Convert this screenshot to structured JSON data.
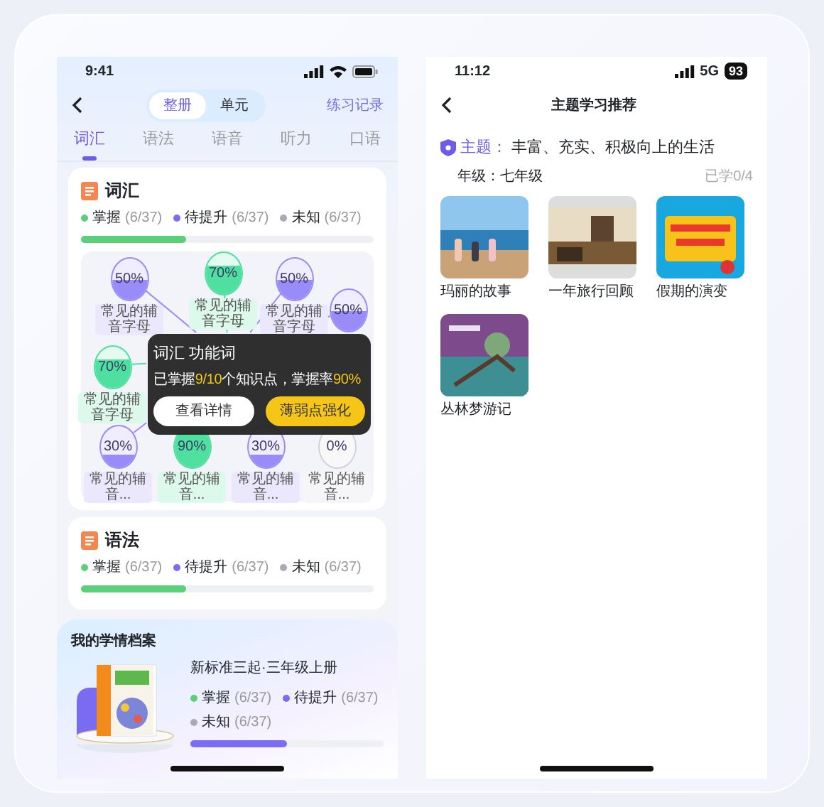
{
  "left_phone": {
    "status_bar": {
      "time": "9:41"
    },
    "header": {
      "segments": [
        {
          "label": "整册",
          "selected": true
        },
        {
          "label": "单元",
          "selected": false
        }
      ],
      "link": "练习记录"
    },
    "tabs": [
      {
        "label": "词汇",
        "selected": true
      },
      {
        "label": "语法",
        "selected": false
      },
      {
        "label": "语音",
        "selected": false
      },
      {
        "label": "听力",
        "selected": false
      },
      {
        "label": "口语",
        "selected": false
      }
    ],
    "sections": [
      {
        "title": "词汇",
        "legend": [
          {
            "label": "掌握",
            "count": "(6/37)",
            "color": "#5ccf7a"
          },
          {
            "label": "待提升",
            "count": "(6/37)",
            "color": "#7b6cf6"
          },
          {
            "label": "未知",
            "count": "(6/37)",
            "color": "#a8abb6"
          }
        ],
        "progress": {
          "level": 0.36
        },
        "graph": {
          "nodes": [
            {
              "percent": "50%",
              "label": "常见的辅音字母",
              "color": "#9a8cf8",
              "level": 0.5
            },
            {
              "percent": "70%",
              "label": "常见的辅音字母",
              "color": "#4fe0a0",
              "level": 0.7
            },
            {
              "percent": "50%",
              "label": "常见的辅音字母",
              "color": "#9a8cf8",
              "level": 0.5
            },
            {
              "percent": "50%",
              "color": "#9a8cf8",
              "level": 0.5
            },
            {
              "percent": "70%",
              "label": "常见的辅音字母",
              "color": "#4fe0a0",
              "level": 0.7
            },
            {
              "percent": "30%",
              "label": "常见的辅音...",
              "color": "#9a8cf8",
              "level": 0.3
            },
            {
              "percent": "90%",
              "label": "常见的辅音...",
              "color": "#4fe0a0",
              "level": 0.9
            },
            {
              "percent": "30%",
              "label": "常见的辅音...",
              "color": "#9a8cf8",
              "level": 0.3
            },
            {
              "percent": "0%",
              "label": "常见的辅音...",
              "color": "#d2d3da",
              "level": 0
            }
          ],
          "tooltip": {
            "title": "词汇 功能词",
            "segments": [
              {
                "text": "已掌握",
                "highlight": false
              },
              {
                "text": "9/10",
                "highlight": true
              },
              {
                "text": "个知识点，掌握率",
                "highlight": false
              },
              {
                "text": "90%",
                "highlight": true
              }
            ],
            "buttons": [
              {
                "label": "查看详情",
                "kind": "secondary"
              },
              {
                "label": "薄弱点强化",
                "kind": "primary"
              }
            ]
          }
        }
      },
      {
        "title": "语法",
        "legend": [
          {
            "label": "掌握",
            "count": "(6/37)",
            "color": "#5ccf7a"
          },
          {
            "label": "待提升",
            "count": "(6/37)",
            "color": "#7b6cf6"
          },
          {
            "label": "未知",
            "count": "(6/37)",
            "color": "#a8abb6"
          }
        ],
        "progress": {
          "level": 0.36
        }
      }
    ],
    "profile": {
      "title": "我的学情档案",
      "book_title": "新标准三起·三年级上册",
      "legend": [
        {
          "label": "掌握",
          "count": "(6/37)",
          "color": "#5ccf7a"
        },
        {
          "label": "待提升",
          "count": "(6/37)",
          "color": "#7b6cf6"
        },
        {
          "label": "未知",
          "count": "(6/37)",
          "color": "#a8abb6"
        }
      ],
      "progress": {
        "level": 0.5
      }
    }
  },
  "right_phone": {
    "status_bar": {
      "time": "11:12",
      "network": "5G",
      "battery": "93"
    },
    "title": "主题学习推荐",
    "theme": {
      "label": "主题：",
      "value": "丰富、充实、积极向上的生活"
    },
    "grade": "年级：七年级",
    "progress_text": "已学0/4",
    "items": [
      {
        "title": "玛丽的故事",
        "kind": "beach"
      },
      {
        "title": "一年旅行回顾",
        "kind": "room"
      },
      {
        "title": "假期的演变",
        "kind": "yellow-cover"
      },
      {
        "title": "丛林梦游记",
        "kind": "purple-cover"
      }
    ]
  }
}
